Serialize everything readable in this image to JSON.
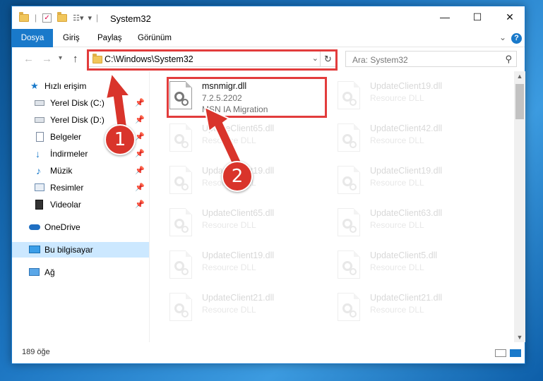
{
  "window": {
    "title": "System32"
  },
  "ribbon": {
    "tabs": [
      "Dosya",
      "Giriş",
      "Paylaş",
      "Görünüm"
    ]
  },
  "nav": {
    "address": "C:\\Windows\\System32",
    "search_placeholder": "Ara: System32"
  },
  "sidebar": {
    "items": [
      {
        "label": "Hızlı erişim",
        "icon": "star-icon"
      },
      {
        "label": "Yerel Disk (C:)",
        "icon": "drive-icon",
        "pinned": true
      },
      {
        "label": "Yerel Disk (D:)",
        "icon": "drive-icon",
        "pinned": true
      },
      {
        "label": "Belgeler",
        "icon": "documents-icon",
        "pinned": true
      },
      {
        "label": "İndirmeler",
        "icon": "download-icon",
        "pinned": true
      },
      {
        "label": "Müzik",
        "icon": "music-icon",
        "pinned": true
      },
      {
        "label": "Resimler",
        "icon": "pictures-icon",
        "pinned": true
      },
      {
        "label": "Videolar",
        "icon": "videos-icon",
        "pinned": true
      },
      {
        "label": "OneDrive",
        "icon": "cloud-icon"
      },
      {
        "label": "Bu bilgisayar",
        "icon": "computer-icon",
        "selected": true
      },
      {
        "label": "Ağ",
        "icon": "network-icon"
      }
    ]
  },
  "files": [
    {
      "name": "msnmigr.dll",
      "line2": "7.2.5.2202",
      "line3": "MSN IA Migration",
      "highlighted": true
    },
    {
      "name": "UpdateClient19.dll",
      "line2": "Resource DLL"
    },
    {
      "name": "UpdateClient65.dll",
      "line2": "Resource DLL"
    },
    {
      "name": "UpdateClient42.dll",
      "line2": "Resource DLL"
    },
    {
      "name": "UpdateClient19.dll",
      "line2": "Resource DLL"
    },
    {
      "name": "UpdateClient19.dll",
      "line2": "Resource DLL"
    },
    {
      "name": "UpdateClient65.dll",
      "line2": "Resource DLL"
    },
    {
      "name": "UpdateClient63.dll",
      "line2": "Resource DLL"
    },
    {
      "name": "UpdateClient19.dll",
      "line2": "Resource DLL"
    },
    {
      "name": "UpdateClient5.dll",
      "line2": "Resource DLL"
    },
    {
      "name": "UpdateClient21.dll",
      "line2": "Resource DLL"
    },
    {
      "name": "UpdateClient21.dll",
      "line2": "Resource DLL"
    }
  ],
  "status": {
    "count": "189 öğe"
  },
  "annotations": {
    "step1": "1",
    "step2": "2",
    "color": "#d9342b"
  }
}
